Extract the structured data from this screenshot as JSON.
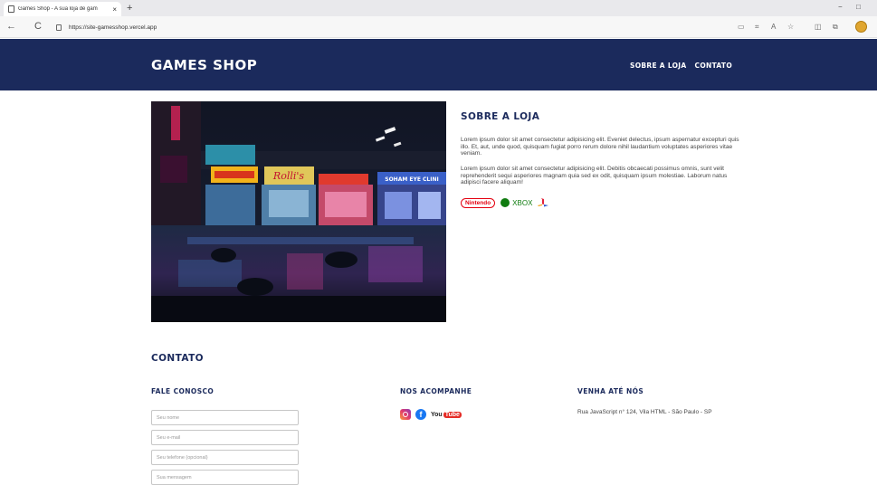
{
  "browser": {
    "tab_title": "Games Shop - A sua loja de gam",
    "tab_close": "×",
    "new_tab": "+",
    "url": "https://site-gamesshop.vercel.app",
    "back": "←",
    "refresh": "C",
    "minimize": "−",
    "restore": "□"
  },
  "header": {
    "logo": "GAMES SHOP",
    "nav": [
      "SOBRE A LOJA",
      "CONTATO"
    ],
    "bg_color": "#1b2a5c"
  },
  "sobre": {
    "title": "SOBRE A LOJA",
    "paragraph1": "Lorem ipsum dolor sit amet consectetur adipisicing elit. Eveniet delectus, ipsum aspernatur excepturi quis illo. Et, aut, unde quod, quisquam fugiat porro rerum dolore nihil laudantium voluptates asperiores vitae veniam.",
    "paragraph2": "Lorem ipsum dolor sit amet consectetur adipisicing elit. Debitis obcaecati possimus omnis, sunt velit reprehenderit sequi asperiores magnam quia sed ex odit, quisquam ipsum molestiae. Laborum natus adipisci facere aliquam!",
    "brands": {
      "nintendo": "Nintendo",
      "xbox": "XBOX"
    },
    "image_signs": [
      "Rolli's",
      "SOHAM EYE CLINI"
    ]
  },
  "contato": {
    "title": "CONTATO",
    "fale_conosco": "FALE CONOSCO",
    "nos_acompanhe": "NOS ACOMPANHE",
    "venha_ate_nos": "VENHA ATÉ NÓS",
    "address": "Rua JavaScript n° 124, Vila HTML - São Paulo - SP",
    "form": {
      "name_placeholder": "Seu nome",
      "email_placeholder": "Seu e-mail",
      "phone_placeholder": "Seu telefone (opcional)",
      "message_placeholder": "Sua mensagem"
    },
    "social": {
      "youtube_you": "You",
      "youtube_tube": "Tube"
    }
  }
}
